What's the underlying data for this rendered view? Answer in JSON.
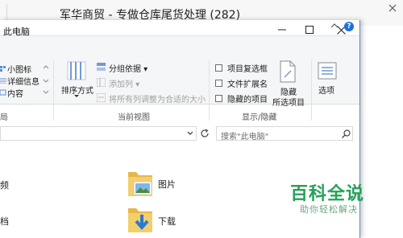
{
  "background_window": {
    "title": "军华商贸 - 专做仓库尾货处理 (282)"
  },
  "window": {
    "title": "此电脑"
  },
  "ribbon": {
    "layout": {
      "items": [
        "小图标",
        "详细信息",
        "内容"
      ]
    },
    "current_view": {
      "sort_label": "排序方式",
      "group_by": "分组依据",
      "add_column": "添加列",
      "fit_columns": "将所有列调整为合适的大小",
      "group_label": "当前视图"
    },
    "show_hide": {
      "item_checkboxes": "项目复选框",
      "file_extensions": "文件扩展名",
      "hidden_items": "隐藏的项目",
      "hide_selected_line1": "隐藏",
      "hide_selected_line2": "所选项目",
      "group_label": "显示/隐藏"
    },
    "options_label": "选项",
    "left_group_partial": "局"
  },
  "search": {
    "placeholder": "搜索\"此电脑\""
  },
  "content": {
    "items": [
      {
        "label": "图片",
        "icon": "pictures-folder-icon"
      },
      {
        "label": "下载",
        "icon": "downloads-folder-icon"
      }
    ],
    "left_partial": [
      "频",
      "档"
    ]
  },
  "watermark": {
    "title": "百科全说",
    "subtitle": "助你轻松解决"
  },
  "colors": {
    "accent": "#1c73d6",
    "watermark": "#26a05a"
  }
}
